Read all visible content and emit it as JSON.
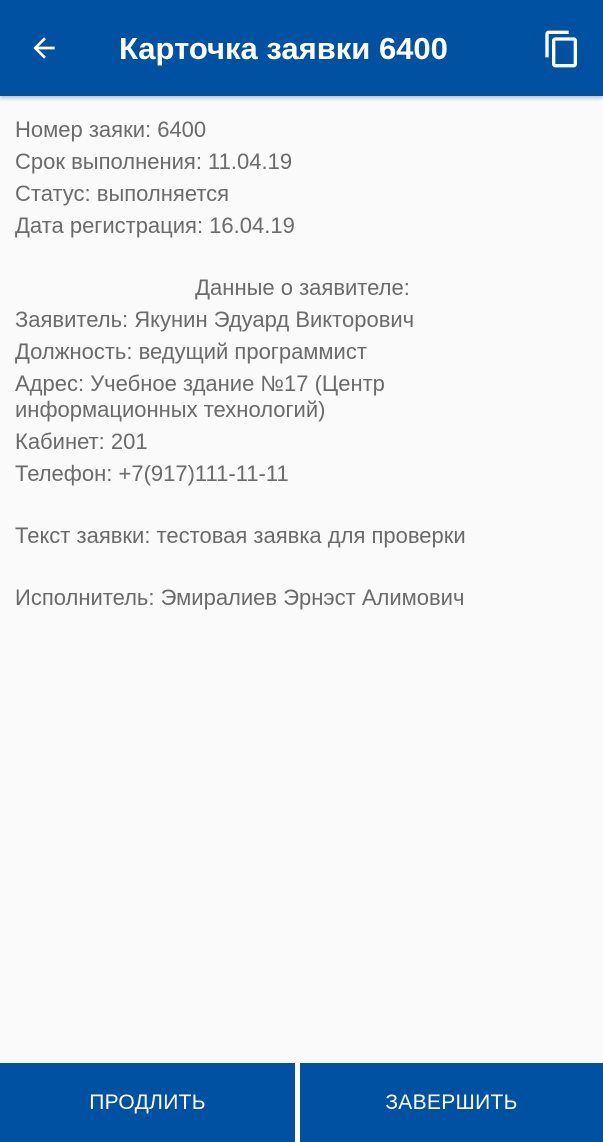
{
  "appbar": {
    "title": "Карточка заявки 6400",
    "back_icon": "arrow-left-icon",
    "copy_icon": "copy-icon",
    "color": "#0051a2"
  },
  "request": {
    "number": "Номер заяки: 6400",
    "deadline": "Срок выполнения: 11.04.19",
    "status": "Статус: выполняется",
    "registration_date": "Дата регистрация: 16.04.19"
  },
  "applicant": {
    "section_title": "Данные о заявителе:",
    "name": "Заявитель: Якунин Эдуард Викторович",
    "position": "Должность: ведущий программист",
    "address": "Адрес: Учебное здание №17 (Центр информационных технологий)",
    "office": "Кабинет: 201",
    "phone": "Телефон: +7(917)111-11-11"
  },
  "request_text": "Текст заявки: тестовая заявка для проверки",
  "executor": "Исполнитель: Эмиралиев Эрнэст Алимович",
  "buttons": {
    "extend": "ПРОДЛИТЬ",
    "complete": "ЗАВЕРШИТЬ"
  }
}
